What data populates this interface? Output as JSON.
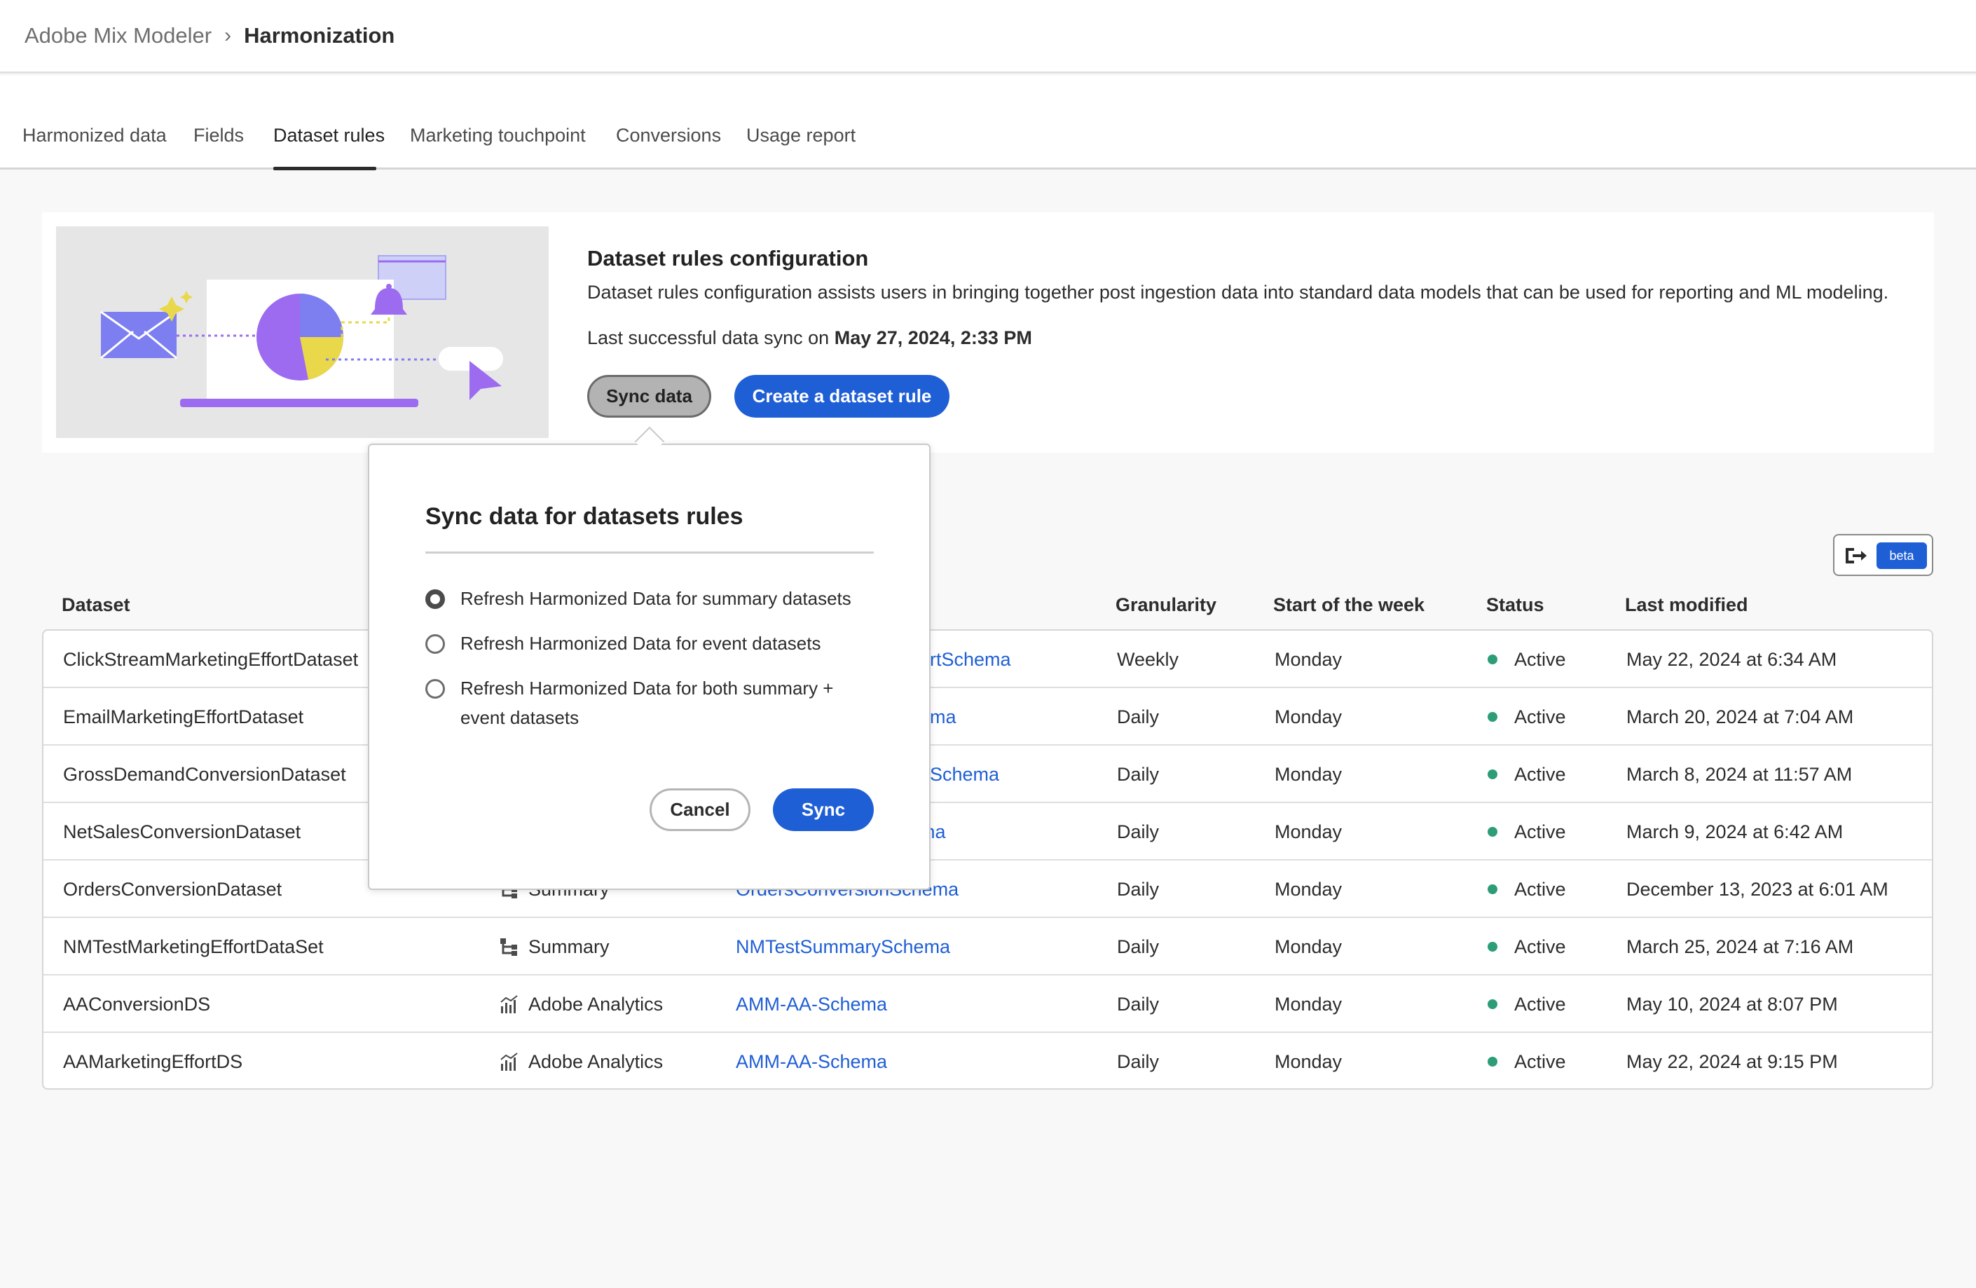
{
  "breadcrumb": {
    "root": "Adobe Mix Modeler",
    "separator": "›",
    "current": "Harmonization"
  },
  "tabs": [
    {
      "label": "Harmonized data"
    },
    {
      "label": "Fields"
    },
    {
      "label": "Dataset rules",
      "active": true
    },
    {
      "label": "Marketing touchpoint"
    },
    {
      "label": "Conversions"
    },
    {
      "label": "Usage report"
    }
  ],
  "hero": {
    "title": "Dataset rules configuration",
    "description": "Dataset rules configuration assists users in bringing together post ingestion data into standard data models that can be used for reporting and ML modeling.",
    "sync_prefix": "Last successful data sync on",
    "sync_date": "May 27, 2024, 2:33 PM",
    "sync_button": "Sync data",
    "create_button": "Create a dataset rule"
  },
  "beta_label": "beta",
  "table": {
    "headers": {
      "dataset": "Dataset",
      "granularity": "Granularity",
      "week_start": "Start of the week",
      "status": "Status",
      "last_modified": "Last modified"
    },
    "rows": [
      {
        "dataset": "ClickStreamMarketingEffortDataset",
        "source": "",
        "schema": "ortSchema",
        "granularity": "Weekly",
        "week_start": "Monday",
        "status": "Active",
        "last_modified": "May 22, 2024 at 6:34 AM"
      },
      {
        "dataset": "EmailMarketingEffortDataset",
        "source": "",
        "schema": "ema",
        "granularity": "Daily",
        "week_start": "Monday",
        "status": "Active",
        "last_modified": "March 20, 2024 at 7:04 AM"
      },
      {
        "dataset": "GrossDemandConversionDataset",
        "source": "",
        "schema": "nSchema",
        "granularity": "Daily",
        "week_start": "Monday",
        "status": "Active",
        "last_modified": "March 8, 2024 at 11:57 AM"
      },
      {
        "dataset": "NetSalesConversionDataset",
        "source": "",
        "schema": "ma",
        "granularity": "Daily",
        "week_start": "Monday",
        "status": "Active",
        "last_modified": "March 9, 2024 at 6:42 AM"
      },
      {
        "dataset": "OrdersConversionDataset",
        "source": "Summary",
        "schema": "OrdersConversionSchema",
        "granularity": "Daily",
        "week_start": "Monday",
        "status": "Active",
        "last_modified": "December 13, 2023 at 6:01 AM"
      },
      {
        "dataset": "NMTestMarketingEffortDataSet",
        "source": "Summary",
        "schema": "NMTestSummarySchema",
        "granularity": "Daily",
        "week_start": "Monday",
        "status": "Active",
        "last_modified": "March 25, 2024 at 7:16 AM"
      },
      {
        "dataset": "AAConversionDS",
        "source": "Adobe Analytics",
        "schema": "AMM-AA-Schema",
        "granularity": "Daily",
        "week_start": "Monday",
        "status": "Active",
        "last_modified": "May 10, 2024 at 8:07 PM"
      },
      {
        "dataset": "AAMarketingEffortDS",
        "source": "Adobe Analytics",
        "schema": "AMM-AA-Schema",
        "granularity": "Daily",
        "week_start": "Monday",
        "status": "Active",
        "last_modified": "May 22, 2024 at 9:15 PM"
      }
    ]
  },
  "popover": {
    "title": "Sync data for datasets rules",
    "options": [
      {
        "label": "Refresh Harmonized Data for summary datasets",
        "checked": true
      },
      {
        "label": "Refresh Harmonized Data for event datasets",
        "checked": false
      },
      {
        "label": "Refresh Harmonized Data for both summary + event datasets",
        "checked": false
      }
    ],
    "cancel": "Cancel",
    "confirm": "Sync"
  },
  "colors": {
    "accent": "#1f5fd6",
    "status_active": "#2d9d78",
    "illustration_purple": "#9c6bf0",
    "illustration_yellow": "#e8d84a"
  }
}
